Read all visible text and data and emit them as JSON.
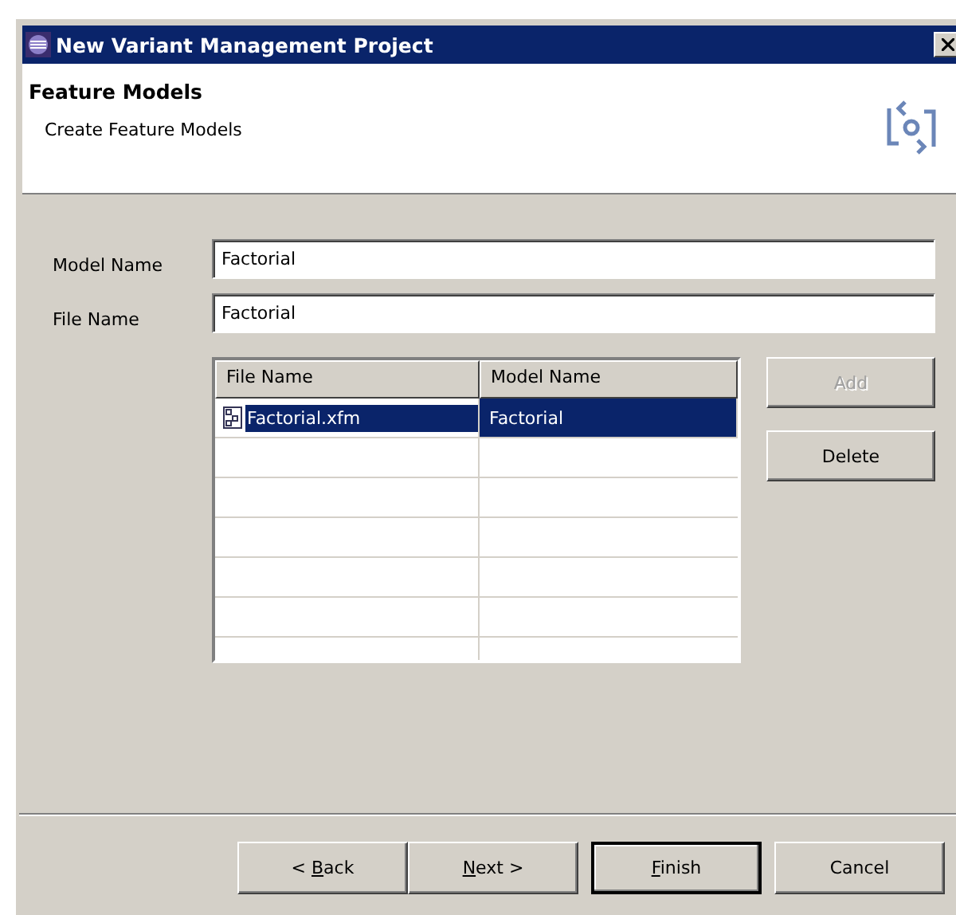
{
  "window": {
    "title": "New Variant Management Project"
  },
  "header": {
    "title": "Feature Models",
    "subtitle": "Create Feature Models"
  },
  "fields": [
    {
      "label": "Model Name",
      "value": "Factorial"
    },
    {
      "label": "File Name",
      "value": "Factorial"
    }
  ],
  "table": {
    "columns": [
      "File Name",
      "Model Name"
    ],
    "rows": [
      {
        "cells": [
          "Factorial.xfm",
          "Factorial"
        ],
        "selected": true
      }
    ]
  },
  "side_buttons": [
    {
      "label": "Add",
      "disabled": true
    },
    {
      "label": "Delete",
      "disabled": false
    }
  ],
  "buttons": [
    {
      "before": "< ",
      "key": "B",
      "after": "ack",
      "default": false
    },
    {
      "key": "N",
      "after": "ext >",
      "default": false
    },
    {
      "key": "F",
      "after": "inish",
      "default": true
    },
    {
      "before": "Cancel",
      "default": false
    }
  ]
}
